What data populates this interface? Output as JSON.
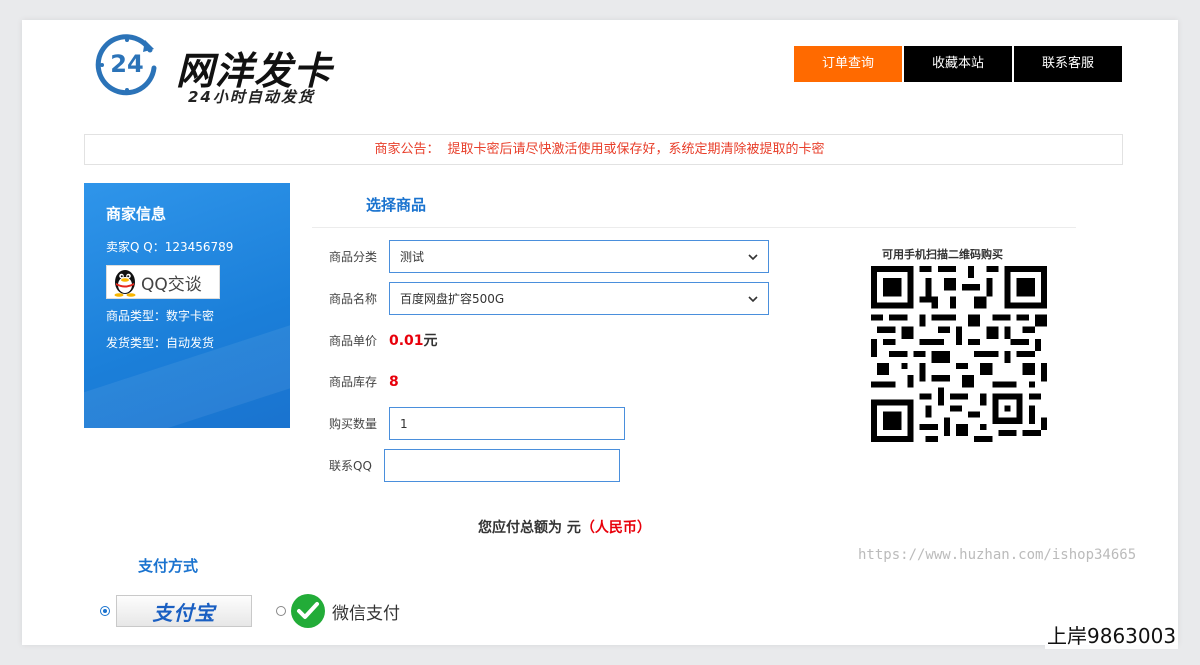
{
  "header": {
    "logo_number": "24",
    "logo_title": "网洋发卡",
    "logo_subtitle": "24小时自动发货",
    "nav": [
      {
        "label": "订单查询",
        "active": true
      },
      {
        "label": "收藏本站",
        "active": false
      },
      {
        "label": "联系客服",
        "active": false
      }
    ]
  },
  "notice": {
    "label": "商家公告：",
    "text": "提取卡密后请尽快激活使用或保存好，系统定期清除被提取的卡密"
  },
  "seller": {
    "title": "商家信息",
    "qq_line": "卖家Q Q：123456789",
    "qq_badge": "QQ交谈",
    "type_line": "商品类型：数字卡密",
    "ship_line": "发货类型：自动发货"
  },
  "form": {
    "section_title": "选择商品",
    "category_label": "商品分类",
    "category_value": "测试",
    "name_label": "商品名称",
    "name_value": "百度网盘扩容500G",
    "price_label": "商品单价",
    "price_value": "0.01",
    "price_unit": "元",
    "stock_label": "商品库存",
    "stock_value": "8",
    "qty_label": "购买数量",
    "qty_value": "1",
    "contact_label": "联系QQ",
    "contact_value": ""
  },
  "qr": {
    "caption": "可用手机扫描二维码购买"
  },
  "total": {
    "prefix": "您应付总额为 元",
    "currency": "（人民币）"
  },
  "watermark": "https://www.huzhan.com/ishop34665",
  "payment": {
    "title": "支付方式",
    "alipay_label": "支付宝",
    "wechat_label": "微信支付"
  },
  "corner_text": "上岸9863003",
  "colors": {
    "accent_orange": "#ff6a00",
    "accent_blue": "#1a73cf",
    "alert_red": "#e83e2a",
    "price_red": "#e8000b"
  }
}
